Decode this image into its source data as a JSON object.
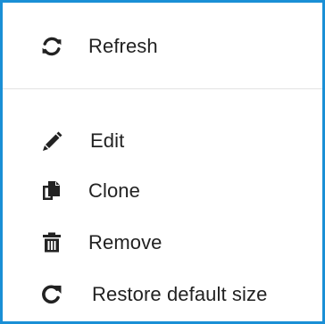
{
  "context_menu": {
    "items": [
      {
        "label": "Refresh",
        "icon": "refresh-icon"
      },
      {
        "label": "Edit",
        "icon": "pencil-icon"
      },
      {
        "label": "Clone",
        "icon": "copy-icon"
      },
      {
        "label": "Remove",
        "icon": "trash-icon"
      },
      {
        "label": "Restore default size",
        "icon": "restore-icon"
      }
    ],
    "accent_color": "#1a8fd6",
    "text_color": "#222222"
  }
}
